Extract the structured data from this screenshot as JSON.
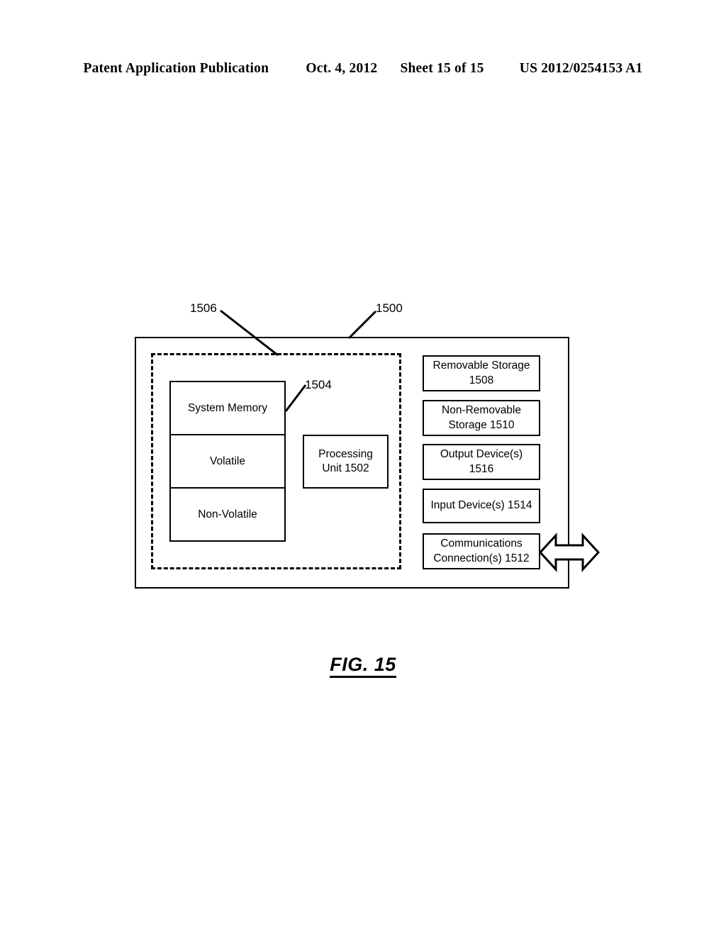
{
  "header": {
    "publication": "Patent Application Publication",
    "date": "Oct. 4, 2012",
    "sheet": "Sheet 15 of 15",
    "patent_number": "US 2012/0254153 A1"
  },
  "figure": {
    "caption": "FIG. 15",
    "system_ref": "1500",
    "dashed_boundary_ref": "1506",
    "system_memory_ref": "1504",
    "memory_stack": {
      "cells": [
        {
          "label": "System Memory"
        },
        {
          "label": "Volatile"
        },
        {
          "label": "Non-Volatile"
        }
      ]
    },
    "processing_unit": {
      "line1": "Processing",
      "line2": "Unit 1502"
    },
    "peripherals": [
      {
        "line1": "Removable Storage",
        "line2": "1508"
      },
      {
        "line1": "Non-Removable",
        "line2": "Storage 1510"
      },
      {
        "line1": "Output Device(s)",
        "line2": "1516"
      },
      {
        "line1": "Input Device(s) 1514",
        "line2": ""
      },
      {
        "line1": "Communications",
        "line2": "Connection(s) 1512"
      }
    ],
    "arrow": "double-headed-arrow"
  },
  "colors": {
    "ink": "#000000",
    "paper": "#ffffff"
  }
}
